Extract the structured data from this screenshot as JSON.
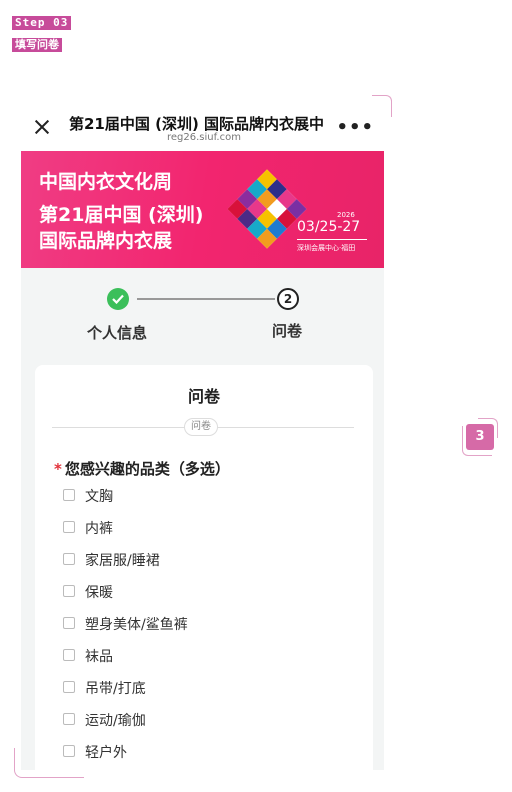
{
  "step_tag": {
    "step": "Step 03",
    "title": "填写问卷"
  },
  "badge": "3",
  "topbar": {
    "title": "第21届中国 (深圳) 国际品牌内衣展中",
    "url": "reg26.siuf.com",
    "more": "•••"
  },
  "banner": {
    "line1": "中国内衣文化周",
    "line2": "第21届中国 (深圳)",
    "line3": "国际品牌内衣展",
    "year": "2026",
    "dates": "03/25-27",
    "venue": "深圳会展中心·福田"
  },
  "progress": {
    "step1": "个人信息",
    "step2_num": "2",
    "step2": "问卷"
  },
  "card": {
    "title": "问卷",
    "divider_tag": "问卷",
    "question": {
      "required_mark": "*",
      "text": "您感兴趣的品类（多选）"
    },
    "options": [
      "文胸",
      "内裤",
      "家居服/睡裙",
      "保暖",
      "塑身美体/鲨鱼裤",
      "袜品",
      "吊带/打底",
      "运动/瑜伽",
      "轻户外"
    ]
  }
}
